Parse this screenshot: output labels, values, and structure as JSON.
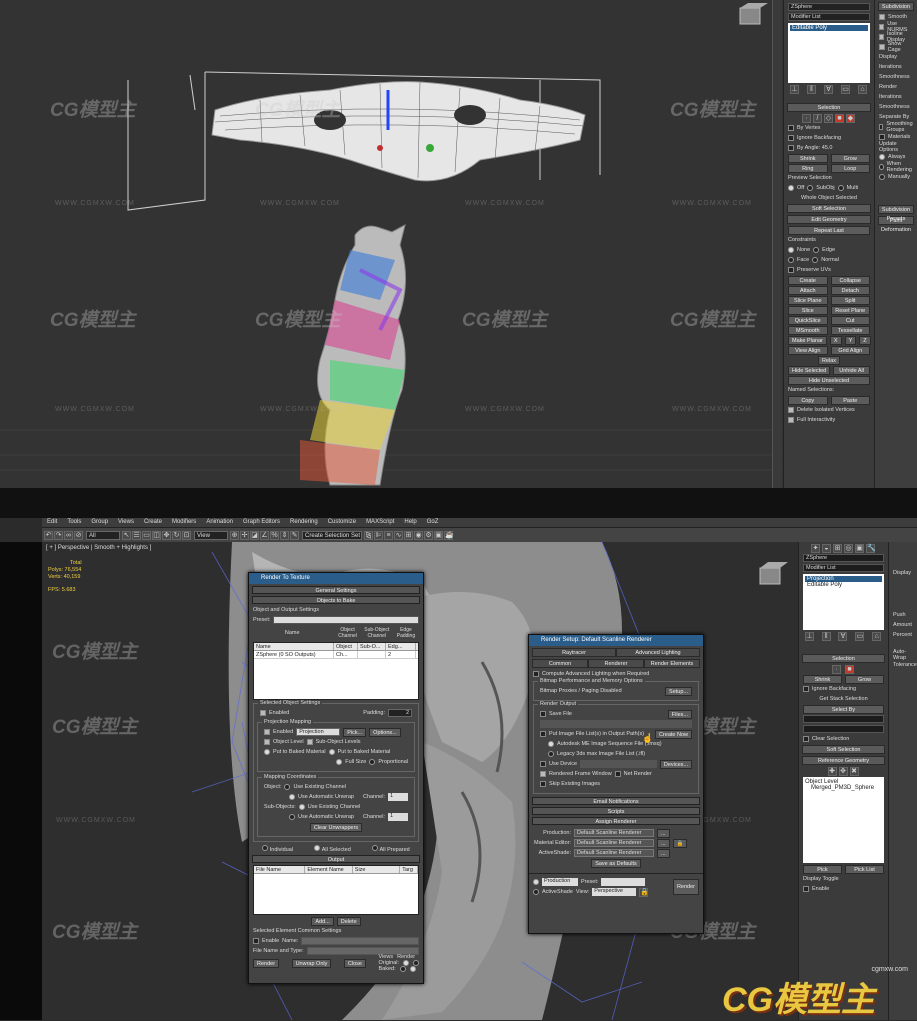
{
  "top": {
    "panel": {
      "object_name": "ZSphere",
      "modifier_list_label": "Modifier List",
      "stack_item": "Editable Poly",
      "right_labels": [
        "Subdivision",
        "Smooth",
        "Use NURMS",
        "Isoline Display",
        "Show Cage",
        "Display",
        "Iterations",
        "Smoothness",
        "Render",
        "Iterations",
        "Smoothness",
        "Separate By",
        "Smoothing Groups",
        "Materials",
        "Update Options",
        "Always",
        "When Rendering",
        "Manually",
        "Subdivision Presets",
        "Paint Deformation"
      ],
      "selection_header": "Selection",
      "selection_options": [
        "By Vertex",
        "Ignore Backfacing",
        "By Angle: 45.0",
        "Shrink",
        "Grow",
        "Ring",
        "Loop"
      ],
      "preview_selection": "Preview Selection",
      "preview_options": [
        "Off",
        "SubObj",
        "Multi"
      ],
      "whole_object": "Whole Object Selected",
      "soft_selection": "Soft Selection",
      "edit_geometry": "Edit Geometry",
      "repeat_last": "Repeat Last",
      "constraints": "Constraints",
      "constraint_options": [
        "None",
        "Edge",
        "Face",
        "Normal"
      ],
      "preserve_uvs": "Preserve UVs",
      "buttons": [
        "Create",
        "Collapse",
        "Attach",
        "Detach",
        "Slice Plane",
        "Split",
        "Slice",
        "Reset Plane",
        "QuickSlice",
        "Cut",
        "MSmooth",
        "Tessellate",
        "Make Planar",
        "X",
        "Y",
        "Z",
        "View Align",
        "Grid Align",
        "Relax",
        "Hide Selected",
        "Unhide All",
        "Hide Unselected",
        "Named Selections:",
        "Copy",
        "Paste",
        "Delete Isolated Vertices",
        "Full Interactivity"
      ]
    },
    "watermark_brand": "CG模型主",
    "watermark_url": "WWW.CGMXW.COM"
  },
  "bottom": {
    "menu": [
      "Edit",
      "Tools",
      "Group",
      "Views",
      "Create",
      "Modifiers",
      "Animation",
      "Graph Editors",
      "Rendering",
      "Customize",
      "MAXScript",
      "Help",
      "GoZ"
    ],
    "view_dropdown": "View",
    "all_dropdown": "All",
    "create_selection_set": "Create Selection Set",
    "viewport_label": "[ + ] Perspective | Smooth + Highlights ]",
    "stats": {
      "total_label": "Total",
      "polys_label": "Polys:",
      "polys": "76,554",
      "verts_label": "Verts:",
      "verts": "40,159",
      "fps_label": "FPS:",
      "fps": "5.683"
    },
    "right_panel": {
      "object_name": "ZSphere",
      "modifier_list": "Modifier List",
      "stack": [
        "Projection",
        "Editable Poly"
      ],
      "display": "Display",
      "amount": "Amount",
      "push": "Push",
      "percent": "Percent",
      "auto_wrap": "Auto-Wrap",
      "tolerance": "Tolerance",
      "selection": "Selection",
      "shrink": "Shrink",
      "grow": "Grow",
      "ignore_backfacing": "Ignore Backfacing",
      "get_stack_selection": "Get Stack Selection",
      "select_by": "Select By",
      "clear_selection": "Clear Selection",
      "soft_selection": "Soft Selection",
      "reference_geometry": "Reference Geometry",
      "list_items": [
        "Object Level",
        "Merged_PM3D_Sphere"
      ],
      "pick": "Pick",
      "pick_list": "Pick List",
      "display_toggle": "Display Toggle",
      "enable": "Enable"
    },
    "rtt": {
      "title": "Render To Texture",
      "general_settings": "General Settings",
      "objects_to_bake": "Objects to Bake",
      "object_output_settings": "Object and Output Settings",
      "preset_label": "Preset:",
      "columns": [
        "Name",
        "Object Channel",
        "Sub-Object Channel",
        "Edge Padding"
      ],
      "row": [
        "Name",
        "Object Ch...",
        "Sub-O...",
        "Edg..."
      ],
      "row2": [
        "ZSphere (0 SO Outputs)",
        "",
        "",
        "2"
      ],
      "selected_object_settings": "Selected Object Settings",
      "enabled": "Enabled",
      "padding": "Padding:",
      "padding_val": "2",
      "projection_mapping": "Projection Mapping",
      "enabled2": "Enabled",
      "projection": "Projection",
      "pick": "Pick...",
      "options": "Options...",
      "object_level": "Object Level",
      "subobject_levels": "Sub-Object Levels",
      "put_to_baked": "Put to Baked Material",
      "put_to_baked2": "Put to Baked Material",
      "full_size": "Full Size",
      "proportional": "Proportional",
      "mapping_coords": "Mapping Coordinates",
      "object": "Object:",
      "use_existing": "Use Existing Channel",
      "use_auto": "Use Automatic Unwrap",
      "channel": "Channel:",
      "channel_val": "1",
      "subobjects": "Sub-Objects:",
      "use_existing2": "Use Existing Channel",
      "use_auto2": "Use Automatic Unwrap",
      "channel_val2": "1",
      "clear_unwrappers": "Clear Unwrappers",
      "individual": "Individual",
      "all_selected": "All Selected",
      "all_prepared": "All Prepared",
      "output": "Output",
      "out_cols": [
        "File Name",
        "Element Name",
        "Size",
        "Targ"
      ],
      "add": "Add...",
      "delete": "Delete",
      "sel_elem_settings": "Selected Element Common Settings",
      "enable": "Enable",
      "name": "Name:",
      "file_name_type": "File Name and Type:",
      "render": "Render",
      "unwrap_only": "Unwrap Only",
      "close": "Close",
      "original": "Original:",
      "baked": "Baked:",
      "views": "Views",
      "render2": "Render"
    },
    "rs": {
      "title": "Render Setup: Default Scanline Renderer",
      "tabs_row1": [
        "Raytracer",
        "Advanced Lighting"
      ],
      "tabs_row2": [
        "Common",
        "Renderer",
        "Render Elements"
      ],
      "compute_advanced": "Compute Advanced Lighting when Required",
      "bitmap_perf": "Bitmap Performance and Memory Options",
      "bitmap_proxies": "Bitmap Proxies / Paging Disabled",
      "setup": "Setup...",
      "render_output": "Render Output",
      "save_file": "Save File",
      "files": "Files...",
      "put_image": "Put Image File List(s) in Output Path(s)",
      "create_now": "Create Now",
      "autodesk_me": "Autodesk ME Image Sequence File (.imsq)",
      "legacy": "Legacy 3ds max Image File List (.ifl)",
      "use_device": "Use Device",
      "devices": "Devices...",
      "rendered_frame_window": "Rendered Frame Window",
      "net_render": "Net Render",
      "skip_existing": "Skip Existing Images",
      "email": "Email Notifications",
      "scripts": "Scripts",
      "assign_renderer": "Assign Renderer",
      "production": "Production:",
      "production_val": "Default Scanline Renderer",
      "material_editor": "Material Editor:",
      "material_val": "Default Scanline Renderer",
      "activeshade": "ActiveShade:",
      "activeshade_val": "Default Scanline Renderer",
      "save_defaults": "Save as Defaults",
      "mode_production": "Production",
      "preset": "Preset:",
      "mode_activeshade": "ActiveShade",
      "view": "View:",
      "view_val": "Perspective",
      "render": "Render"
    },
    "footer_url": "cgmxw.com",
    "footer_brand": "CG模型主"
  }
}
